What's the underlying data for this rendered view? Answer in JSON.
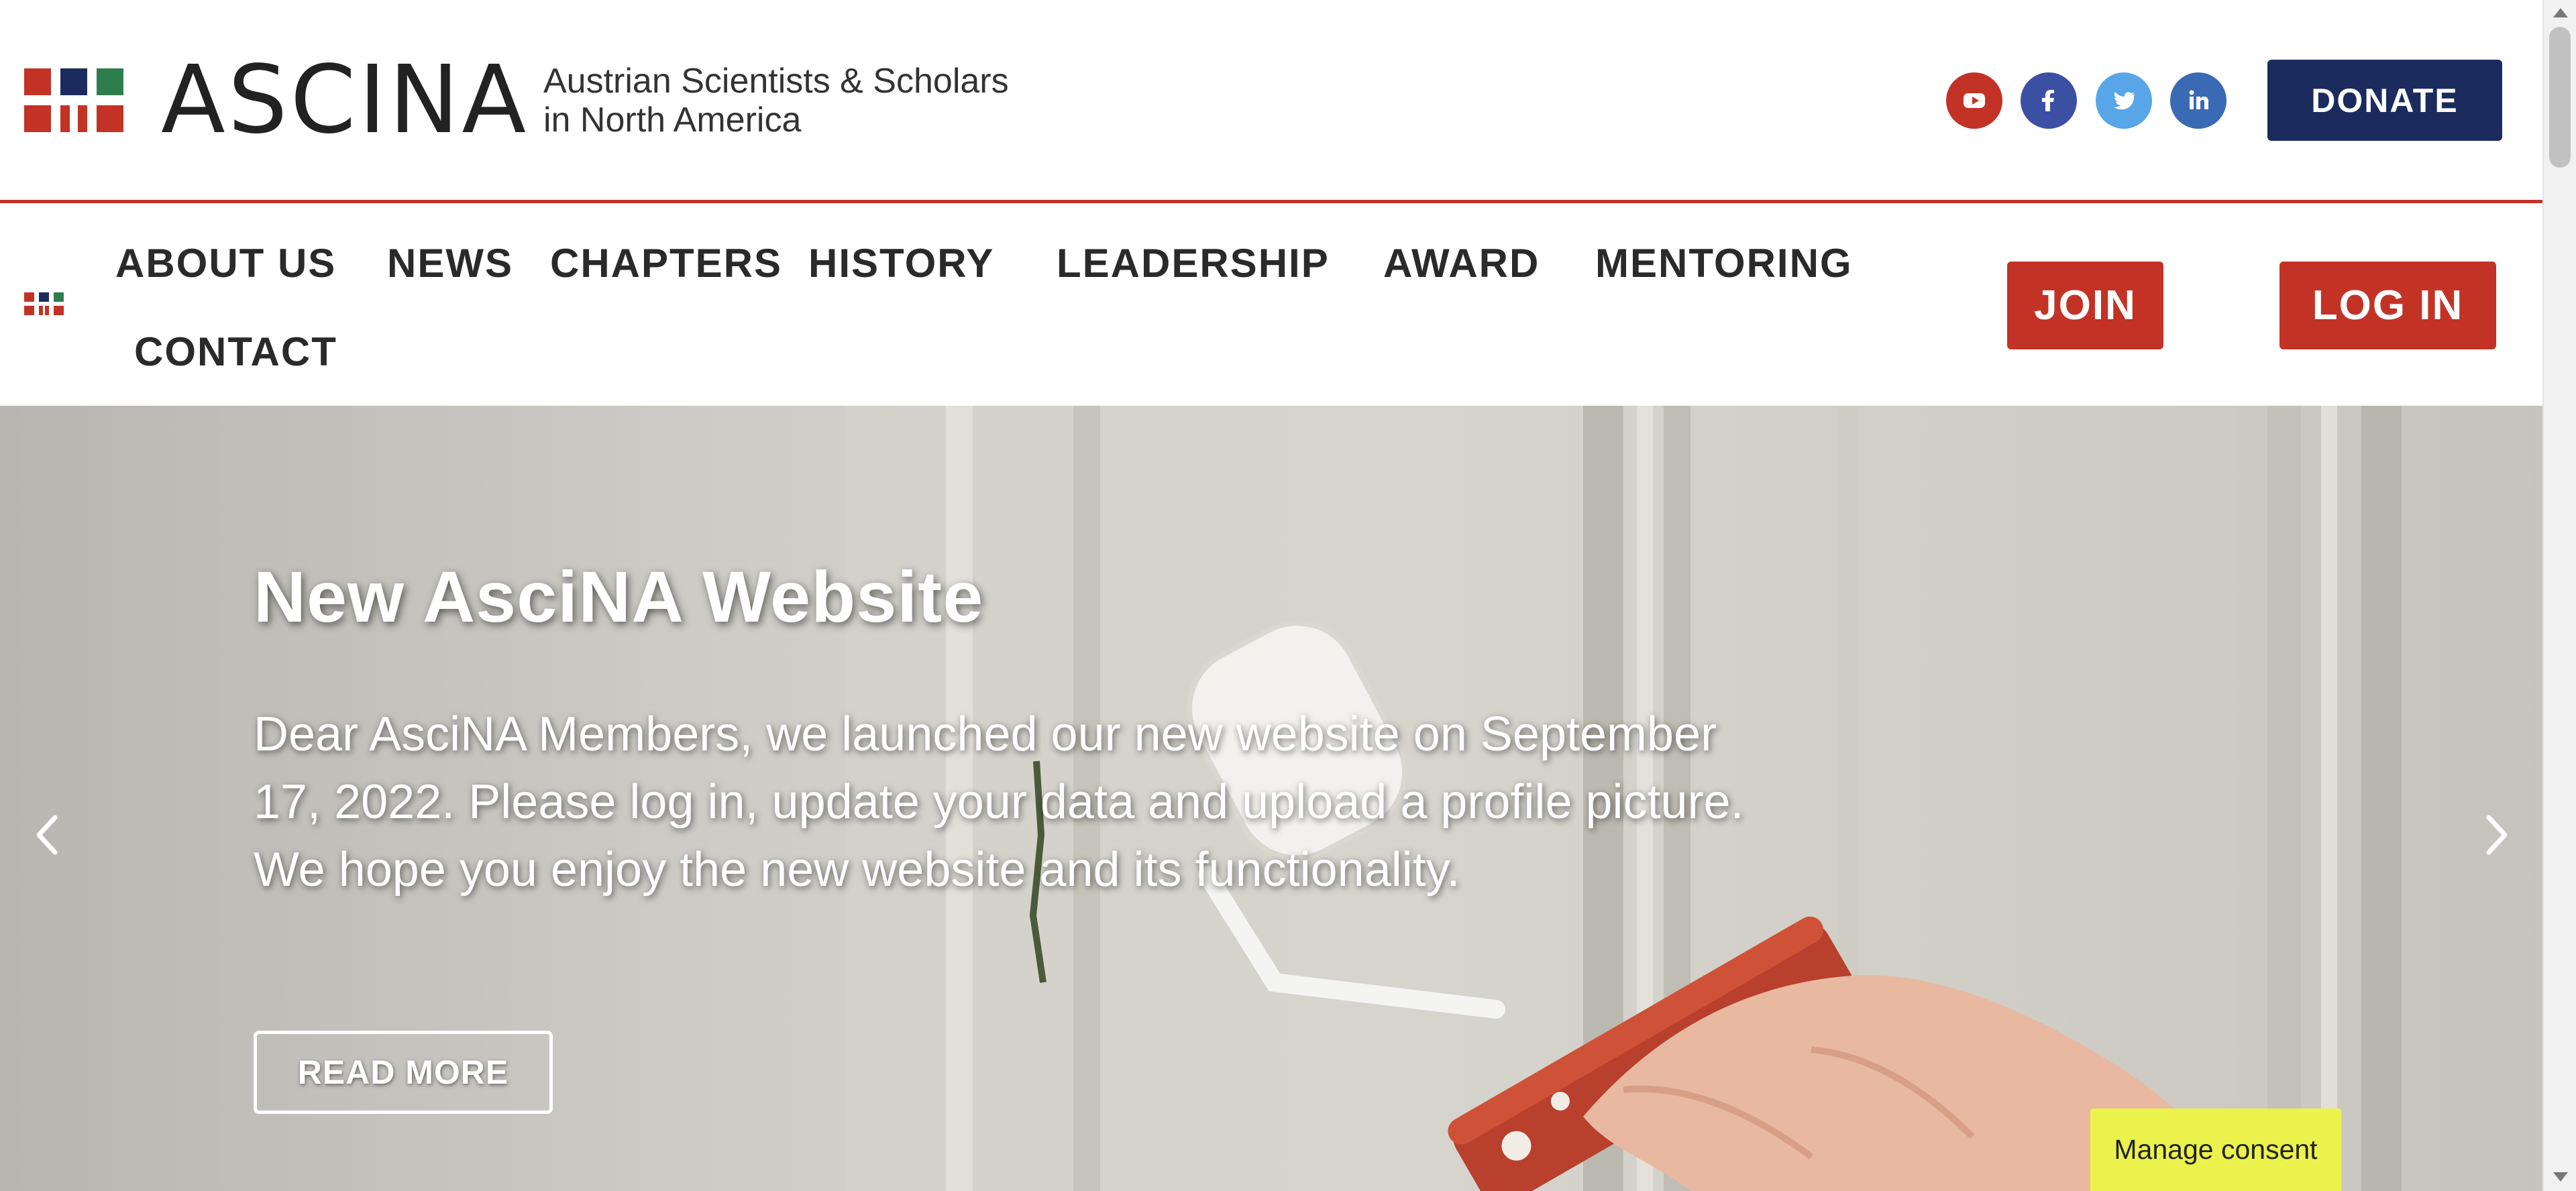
{
  "header": {
    "logo_text": "ASCINA",
    "tagline_line1": "Austrian Scientists & Scholars",
    "tagline_line2": "in North America",
    "social_icons": [
      "youtube-icon",
      "facebook-icon",
      "twitter-icon",
      "linkedin-icon"
    ],
    "donate_label": "DONATE"
  },
  "nav": {
    "items": [
      {
        "label": "ABOUT US"
      },
      {
        "label": "NEWS"
      },
      {
        "label": "CHAPTERS"
      },
      {
        "label": "HISTORY"
      },
      {
        "label": "LEADERSHIP"
      },
      {
        "label": "AWARD"
      },
      {
        "label": "MENTORING"
      },
      {
        "label": "CONTACT"
      }
    ],
    "join_label": "JOIN",
    "login_label": "LOG IN"
  },
  "hero": {
    "title": "New AsciNA Website",
    "body": "Dear AsciNA Members, we launched our new website on September 17, 2022. Please log in, update your data and upload a profile picture. We hope you enjoy the new website and its functionality.",
    "button_label": "READ MORE",
    "prev_icon": "chevron-left-icon",
    "next_icon": "chevron-right-icon"
  },
  "consent": {
    "label": "Manage consent"
  },
  "colors": {
    "brand_red": "#c23326",
    "brand_navy": "#1b2b5e",
    "brand_green": "#2e7d4f",
    "consent_yellow": "#ecf24c"
  }
}
